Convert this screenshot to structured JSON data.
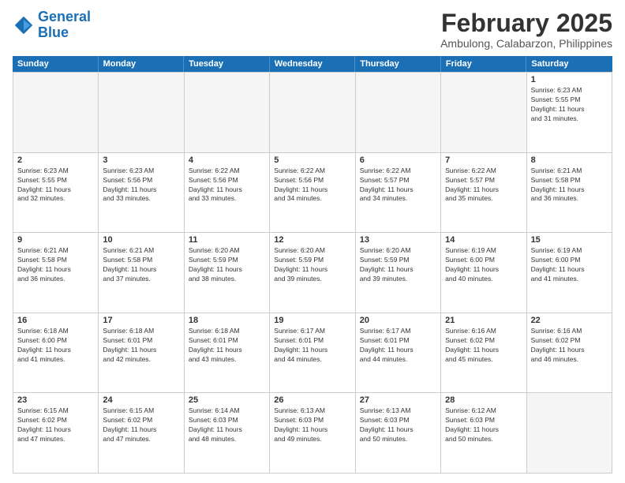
{
  "logo": {
    "line1": "General",
    "line2": "Blue"
  },
  "title": "February 2025",
  "location": "Ambulong, Calabarzon, Philippines",
  "days_of_week": [
    "Sunday",
    "Monday",
    "Tuesday",
    "Wednesday",
    "Thursday",
    "Friday",
    "Saturday"
  ],
  "weeks": [
    [
      {
        "day": "",
        "info": ""
      },
      {
        "day": "",
        "info": ""
      },
      {
        "day": "",
        "info": ""
      },
      {
        "day": "",
        "info": ""
      },
      {
        "day": "",
        "info": ""
      },
      {
        "day": "",
        "info": ""
      },
      {
        "day": "1",
        "info": "Sunrise: 6:23 AM\nSunset: 5:55 PM\nDaylight: 11 hours\nand 31 minutes."
      }
    ],
    [
      {
        "day": "2",
        "info": "Sunrise: 6:23 AM\nSunset: 5:55 PM\nDaylight: 11 hours\nand 32 minutes."
      },
      {
        "day": "3",
        "info": "Sunrise: 6:23 AM\nSunset: 5:56 PM\nDaylight: 11 hours\nand 33 minutes."
      },
      {
        "day": "4",
        "info": "Sunrise: 6:22 AM\nSunset: 5:56 PM\nDaylight: 11 hours\nand 33 minutes."
      },
      {
        "day": "5",
        "info": "Sunrise: 6:22 AM\nSunset: 5:56 PM\nDaylight: 11 hours\nand 34 minutes."
      },
      {
        "day": "6",
        "info": "Sunrise: 6:22 AM\nSunset: 5:57 PM\nDaylight: 11 hours\nand 34 minutes."
      },
      {
        "day": "7",
        "info": "Sunrise: 6:22 AM\nSunset: 5:57 PM\nDaylight: 11 hours\nand 35 minutes."
      },
      {
        "day": "8",
        "info": "Sunrise: 6:21 AM\nSunset: 5:58 PM\nDaylight: 11 hours\nand 36 minutes."
      }
    ],
    [
      {
        "day": "9",
        "info": "Sunrise: 6:21 AM\nSunset: 5:58 PM\nDaylight: 11 hours\nand 36 minutes."
      },
      {
        "day": "10",
        "info": "Sunrise: 6:21 AM\nSunset: 5:58 PM\nDaylight: 11 hours\nand 37 minutes."
      },
      {
        "day": "11",
        "info": "Sunrise: 6:20 AM\nSunset: 5:59 PM\nDaylight: 11 hours\nand 38 minutes."
      },
      {
        "day": "12",
        "info": "Sunrise: 6:20 AM\nSunset: 5:59 PM\nDaylight: 11 hours\nand 39 minutes."
      },
      {
        "day": "13",
        "info": "Sunrise: 6:20 AM\nSunset: 5:59 PM\nDaylight: 11 hours\nand 39 minutes."
      },
      {
        "day": "14",
        "info": "Sunrise: 6:19 AM\nSunset: 6:00 PM\nDaylight: 11 hours\nand 40 minutes."
      },
      {
        "day": "15",
        "info": "Sunrise: 6:19 AM\nSunset: 6:00 PM\nDaylight: 11 hours\nand 41 minutes."
      }
    ],
    [
      {
        "day": "16",
        "info": "Sunrise: 6:18 AM\nSunset: 6:00 PM\nDaylight: 11 hours\nand 41 minutes."
      },
      {
        "day": "17",
        "info": "Sunrise: 6:18 AM\nSunset: 6:01 PM\nDaylight: 11 hours\nand 42 minutes."
      },
      {
        "day": "18",
        "info": "Sunrise: 6:18 AM\nSunset: 6:01 PM\nDaylight: 11 hours\nand 43 minutes."
      },
      {
        "day": "19",
        "info": "Sunrise: 6:17 AM\nSunset: 6:01 PM\nDaylight: 11 hours\nand 44 minutes."
      },
      {
        "day": "20",
        "info": "Sunrise: 6:17 AM\nSunset: 6:01 PM\nDaylight: 11 hours\nand 44 minutes."
      },
      {
        "day": "21",
        "info": "Sunrise: 6:16 AM\nSunset: 6:02 PM\nDaylight: 11 hours\nand 45 minutes."
      },
      {
        "day": "22",
        "info": "Sunrise: 6:16 AM\nSunset: 6:02 PM\nDaylight: 11 hours\nand 46 minutes."
      }
    ],
    [
      {
        "day": "23",
        "info": "Sunrise: 6:15 AM\nSunset: 6:02 PM\nDaylight: 11 hours\nand 47 minutes."
      },
      {
        "day": "24",
        "info": "Sunrise: 6:15 AM\nSunset: 6:02 PM\nDaylight: 11 hours\nand 47 minutes."
      },
      {
        "day": "25",
        "info": "Sunrise: 6:14 AM\nSunset: 6:03 PM\nDaylight: 11 hours\nand 48 minutes."
      },
      {
        "day": "26",
        "info": "Sunrise: 6:13 AM\nSunset: 6:03 PM\nDaylight: 11 hours\nand 49 minutes."
      },
      {
        "day": "27",
        "info": "Sunrise: 6:13 AM\nSunset: 6:03 PM\nDaylight: 11 hours\nand 50 minutes."
      },
      {
        "day": "28",
        "info": "Sunrise: 6:12 AM\nSunset: 6:03 PM\nDaylight: 11 hours\nand 50 minutes."
      },
      {
        "day": "",
        "info": ""
      }
    ]
  ]
}
